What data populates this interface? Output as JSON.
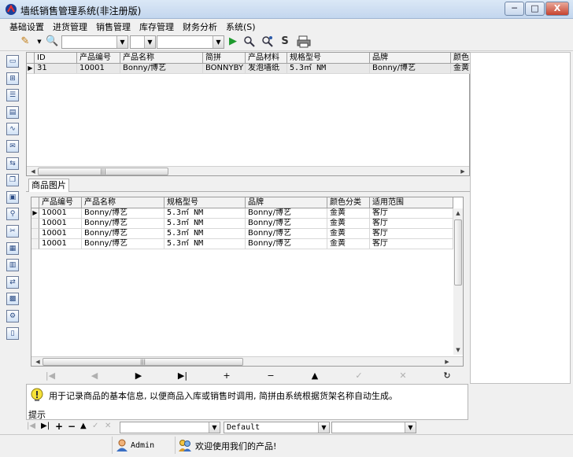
{
  "window": {
    "title": "墙纸销售管理系统(非注册版)",
    "buttons": {
      "minimize": "─",
      "maximize": "□",
      "close": "X"
    }
  },
  "menu": [
    "基础设置",
    "进货管理",
    "销售管理",
    "库存管理",
    "财务分析",
    "系统(S)"
  ],
  "toolbar": {
    "icons": [
      "pencil-icon",
      "search-zoom-icon",
      "play-icon",
      "find-icon",
      "find-next-icon",
      "replace-icon",
      "print-icon"
    ],
    "combos": [
      "",
      "",
      ""
    ]
  },
  "left_icons": [
    "window-icon",
    "tree-icon",
    "list-icon",
    "document-icon",
    "chart-icon",
    "clipboard-icon",
    "export-icon",
    "copy-icon",
    "gift-icon",
    "people-search-icon",
    "scissors-icon",
    "report-icon",
    "sheet-icon",
    "exchange-icon",
    "grid-icon",
    "user-settings-icon",
    "trash-icon"
  ],
  "top_grid": {
    "columns": [
      "ID",
      "产品编号",
      "产品名称",
      "简拼",
      "产品材料",
      "规格型号",
      "品牌",
      "颜色"
    ],
    "rows": [
      [
        "31",
        "10001",
        "Bonny/博艺",
        "BONNYBY",
        "发泡墙纸",
        "5.3㎡ NM",
        "Bonny/博艺",
        "金黄"
      ]
    ]
  },
  "tab": {
    "label": "商品图片"
  },
  "bottom_grid": {
    "columns": [
      "产品编号",
      "产品名称",
      "规格型号",
      "品牌",
      "颜色分类",
      "适用范围"
    ],
    "rows": [
      [
        "10001",
        "Bonny/博艺",
        "5.3㎡ NM",
        "Bonny/博艺",
        "金黄",
        "客厅"
      ],
      [
        "10001",
        "Bonny/博艺",
        "5.3㎡ NM",
        "Bonny/博艺",
        "金黄",
        "客厅"
      ],
      [
        "10001",
        "Bonny/博艺",
        "5.3㎡ NM",
        "Bonny/博艺",
        "金黄",
        "客厅"
      ],
      [
        "10001",
        "Bonny/博艺",
        "5.3㎡ NM",
        "Bonny/博艺",
        "金黄",
        "客厅"
      ]
    ]
  },
  "navigator": {
    "buttons": [
      {
        "name": "first",
        "glyph": "|◀",
        "enabled": false
      },
      {
        "name": "prior",
        "glyph": "◀",
        "enabled": false
      },
      {
        "name": "next",
        "glyph": "▶",
        "enabled": true
      },
      {
        "name": "last",
        "glyph": "▶|",
        "enabled": true
      },
      {
        "name": "insert",
        "glyph": "+",
        "enabled": true
      },
      {
        "name": "delete",
        "glyph": "−",
        "enabled": true
      },
      {
        "name": "edit",
        "glyph": "▲",
        "enabled": true
      },
      {
        "name": "post",
        "glyph": "✓",
        "enabled": false
      },
      {
        "name": "cancel",
        "glyph": "✕",
        "enabled": false
      },
      {
        "name": "refresh",
        "glyph": "↻",
        "enabled": true
      }
    ]
  },
  "hint": {
    "text": "用于记录商品的基本信息, 以便商品入库或销售时调用, 简拼由系统根据货架名称自动生成。",
    "label": "提示"
  },
  "bottom_toolbar": {
    "combo_default": "Default"
  },
  "status": {
    "user": "Admin",
    "message": "欢迎使用我们的产品!"
  }
}
